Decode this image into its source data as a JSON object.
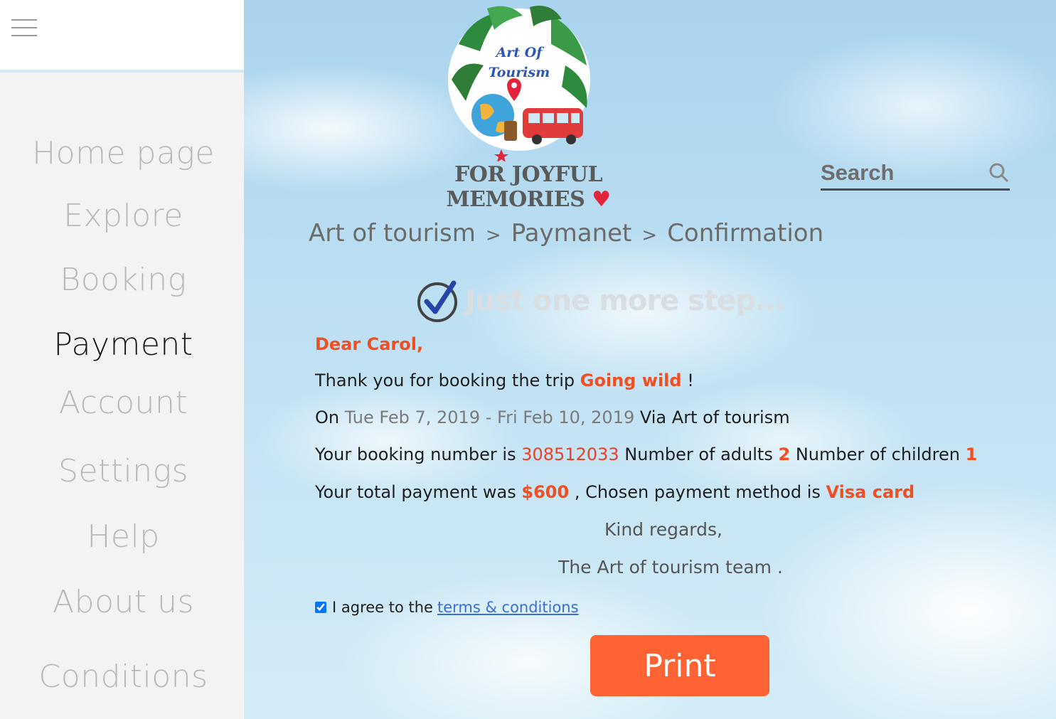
{
  "sidebar": {
    "items": [
      {
        "label": "Home page"
      },
      {
        "label": "Explore"
      },
      {
        "label": "Booking"
      },
      {
        "label": "Payment",
        "active": true
      },
      {
        "label": "Account"
      },
      {
        "label": "Settings"
      },
      {
        "label": "Help"
      },
      {
        "label": "About us"
      },
      {
        "label": "Conditions"
      }
    ]
  },
  "header": {
    "logo_line1": "Art Of",
    "logo_line2": "Tourism",
    "tagline": "FOR JOYFUL MEMORIES",
    "tagline_heart": "♥",
    "search_placeholder": "Search"
  },
  "breadcrumb": {
    "items": [
      "Art of tourism",
      "Paymanet",
      "Confirmation"
    ],
    "separator": ">"
  },
  "step_heading": "Just one more step...",
  "letter": {
    "greeting": "Dear Carol,",
    "thanks_prefix": "Thank you for booking the trip",
    "trip_name": "Going wild",
    "thanks_suffix": "!",
    "on_label": "On",
    "dates": "Tue Feb 7, 2019 - Fri Feb 10, 2019",
    "via": "Via Art of tourism",
    "booking_label": "Your booking number is",
    "booking_number": "308512033",
    "adults_label": "Number of adults",
    "adults": "2",
    "children_label": "Number of children",
    "children": "1",
    "payment_label": "Your total payment was",
    "payment_total": "$600",
    "method_label": ", Chosen payment method is",
    "payment_method": "Visa card",
    "regards": "Kind regards,",
    "signature": "The Art of tourism team ."
  },
  "agreement": {
    "label": "I agree to the",
    "link": "terms & conditions",
    "checked": true
  },
  "print_label": "Print",
  "colors": {
    "accent": "#ff6233",
    "highlight": "#f04e23",
    "sidebar_bg": "#f3f3f3"
  }
}
